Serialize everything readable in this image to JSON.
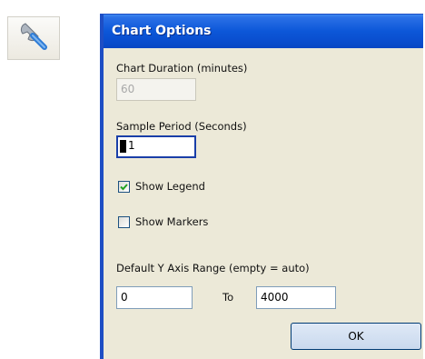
{
  "toolbar": {
    "options_icon": "wrench-icon"
  },
  "dialog": {
    "title": "Chart Options",
    "duration": {
      "label": "Chart Duration (minutes)",
      "value": "60",
      "disabled": true
    },
    "sample": {
      "label": "Sample Period (Seconds)",
      "value": "1",
      "focused": true
    },
    "show_legend": {
      "label": "Show Legend",
      "checked": true
    },
    "show_markers": {
      "label": "Show Markers",
      "checked": false
    },
    "yrange": {
      "label": "Default Y Axis Range (empty = auto)",
      "min": "0",
      "to_label": "To",
      "max": "4000"
    },
    "ok_label": "OK"
  },
  "colors": {
    "title_bar": "#0c57d8",
    "dialog_bg": "#ece9d8",
    "field_border": "#7f9db9"
  }
}
